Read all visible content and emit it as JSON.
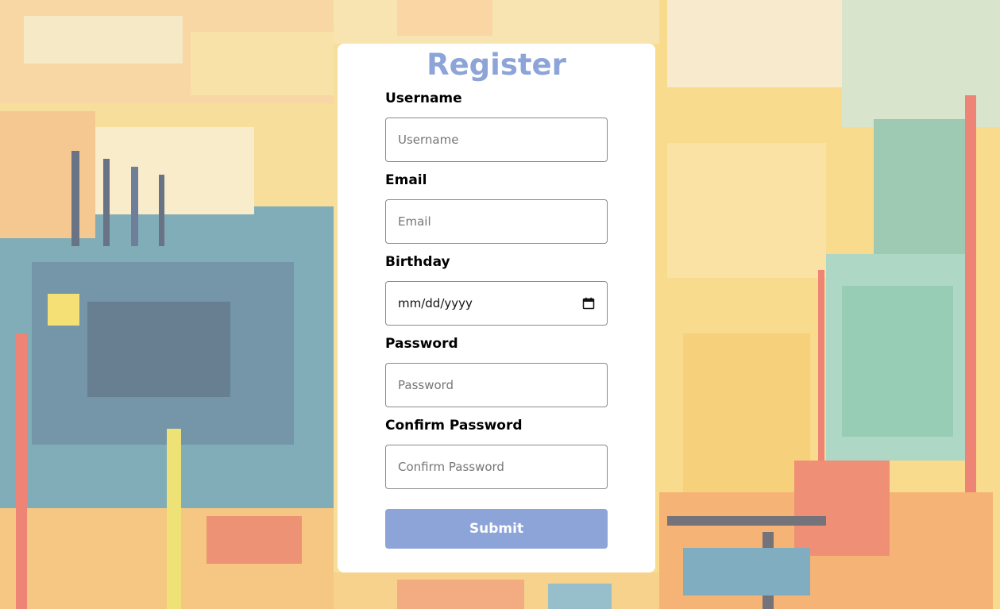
{
  "form": {
    "title": "Register",
    "fields": {
      "username": {
        "label": "Username",
        "placeholder": "Username"
      },
      "email": {
        "label": "Email",
        "placeholder": "Email"
      },
      "birthday": {
        "label": "Birthday",
        "value": "mm/dd/yyyy"
      },
      "password": {
        "label": "Password",
        "placeholder": "Password"
      },
      "confirm_password": {
        "label": "Confirm Password",
        "placeholder": "Confirm Password"
      }
    },
    "submit_label": "Submit"
  },
  "colors": {
    "accent": "#8ca4d8",
    "card": "#ffffff",
    "label": "#000000"
  },
  "icons": {
    "calendar": "calendar-icon"
  }
}
